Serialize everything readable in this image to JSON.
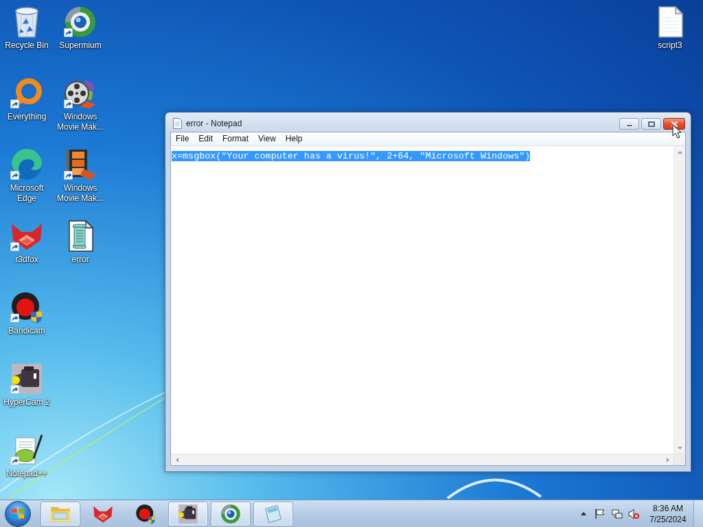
{
  "desktop": {
    "icons": [
      {
        "label": "Recycle Bin",
        "kind": "recycle-bin",
        "shortcut": false
      },
      {
        "label": "Everything",
        "kind": "everything",
        "shortcut": true
      },
      {
        "label": "Microsoft Edge",
        "kind": "edge",
        "shortcut": true
      },
      {
        "label": "r3dfox",
        "kind": "r3dfox",
        "shortcut": true
      },
      {
        "label": "Bandicam",
        "kind": "bandicam",
        "shortcut": true
      },
      {
        "label": "HyperCam 2",
        "kind": "hypercam",
        "shortcut": true
      },
      {
        "label": "Notepad++",
        "kind": "notepadpp",
        "shortcut": true
      },
      {
        "label": "Supermium",
        "kind": "supermium",
        "shortcut": true
      },
      {
        "label": "Windows Movie Mak...",
        "kind": "movie-reel",
        "shortcut": true
      },
      {
        "label": "Windows Movie Mak...",
        "kind": "movie-strip",
        "shortcut": true
      },
      {
        "label": "error",
        "kind": "script",
        "shortcut": false
      }
    ],
    "corner_icons": [
      {
        "label": "script3",
        "kind": "document",
        "shortcut": false
      }
    ]
  },
  "window": {
    "title": "error - Notepad",
    "menu": [
      "File",
      "Edit",
      "Format",
      "View",
      "Help"
    ],
    "text": "x=msgbox(\"Your computer has a virus!\", 2+64, \"Microsoft Windows\")",
    "text_selected": true
  },
  "taskbar": {
    "buttons": [
      {
        "kind": "explorer",
        "running": true
      },
      {
        "kind": "r3dfox",
        "running": false
      },
      {
        "kind": "bandicam",
        "running": false
      },
      {
        "kind": "hypercam",
        "running": true
      },
      {
        "kind": "supermium",
        "running": true
      },
      {
        "kind": "notepad",
        "running": true
      }
    ],
    "time": "8:36 AM",
    "date": "7/25/2024"
  }
}
